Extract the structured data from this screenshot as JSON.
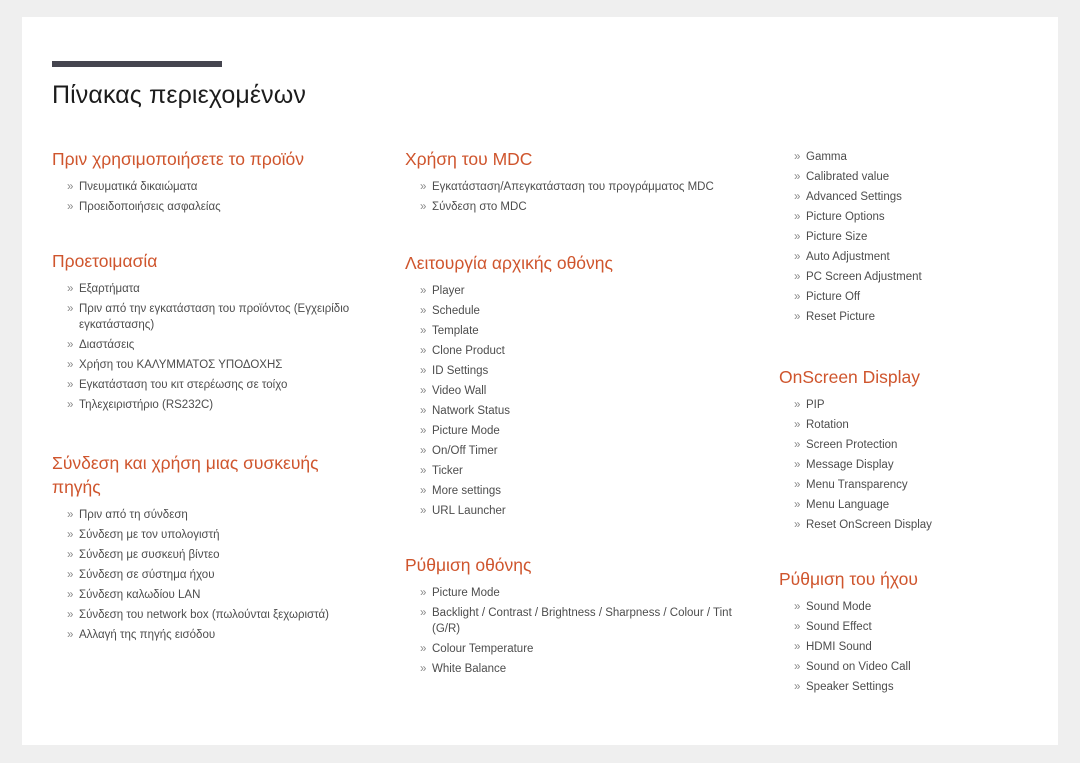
{
  "document": {
    "title": "Πίνακας περιεχομένων",
    "bullet_marker": "»",
    "accent_color": "#cf552d",
    "rule_color": "#45454f",
    "title_color": "#1c1c1c",
    "entry_color": "#4d4d4d",
    "page_background": "#ffffff",
    "canvas_background": "#efefef"
  },
  "columns": {
    "left": [
      {
        "heading": "Πριν χρησιμοποιήσετε το προϊόν",
        "entries": [
          "Πνευματικά δικαιώματα",
          "Προειδοποιήσεις ασφαλείας"
        ]
      },
      {
        "heading": "Προετοιμασία",
        "entries": [
          "Εξαρτήματα",
          "Πριν από την εγκατάσταση του προϊόντος (Εγχειρίδιο εγκατάστασης)",
          "Διαστάσεις",
          "Χρήση του ΚΑΛΥΜΜΑΤΟΣ ΥΠΟΔΟΧΗΣ",
          "Εγκατάσταση του κιτ στερέωσης σε τοίχο",
          "Τηλεχειριστήριο (RS232C)"
        ]
      },
      {
        "heading": "Σύνδεση και χρήση μιας συσκευής πηγής",
        "entries": [
          "Πριν από τη σύνδεση",
          "Σύνδεση με τον υπολογιστή",
          "Σύνδεση με συσκευή βίντεο",
          "Σύνδεση σε σύστημα ήχου",
          "Σύνδεση καλωδίου LAN",
          "Σύνδεση του network box (πωλούνται ξεχωριστά)",
          "Αλλαγή της πηγής εισόδου"
        ]
      }
    ],
    "middle": [
      {
        "heading": "Χρήση του MDC",
        "entries": [
          "Εγκατάσταση/Απεγκατάσταση του προγράμματος MDC",
          "Σύνδεση στο MDC"
        ]
      },
      {
        "heading": "Λειτουργία αρχικής οθόνης",
        "entries": [
          "Player",
          "Schedule",
          "Template",
          "Clone Product",
          "ID Settings",
          "Video Wall",
          "Natwork Status",
          "Picture Mode",
          "On/Off Timer",
          "Ticker",
          "More settings",
          "URL Launcher"
        ]
      },
      {
        "heading": "Ρύθμιση οθόνης",
        "entries": [
          "Picture Mode",
          "Backlight / Contrast / Brightness / Sharpness / Colour / Tint (G/R)",
          "Colour Temperature",
          "White Balance"
        ]
      }
    ],
    "right": [
      {
        "heading": "",
        "entries": [
          "Gamma",
          "Calibrated value",
          "Advanced Settings",
          "Picture Options",
          "Picture Size",
          "Auto Adjustment",
          "PC Screen Adjustment",
          "Picture Off",
          "Reset Picture"
        ]
      },
      {
        "heading": "OnScreen Display",
        "entries": [
          "PIP",
          "Rotation",
          "Screen Protection",
          "Message Display",
          "Menu Transparency",
          "Menu Language",
          "Reset OnScreen Display"
        ]
      },
      {
        "heading": "Ρύθμιση του ήχου",
        "entries": [
          "Sound Mode",
          "Sound Effect",
          "HDMI Sound",
          "Sound on Video Call",
          "Speaker Settings"
        ]
      }
    ]
  }
}
